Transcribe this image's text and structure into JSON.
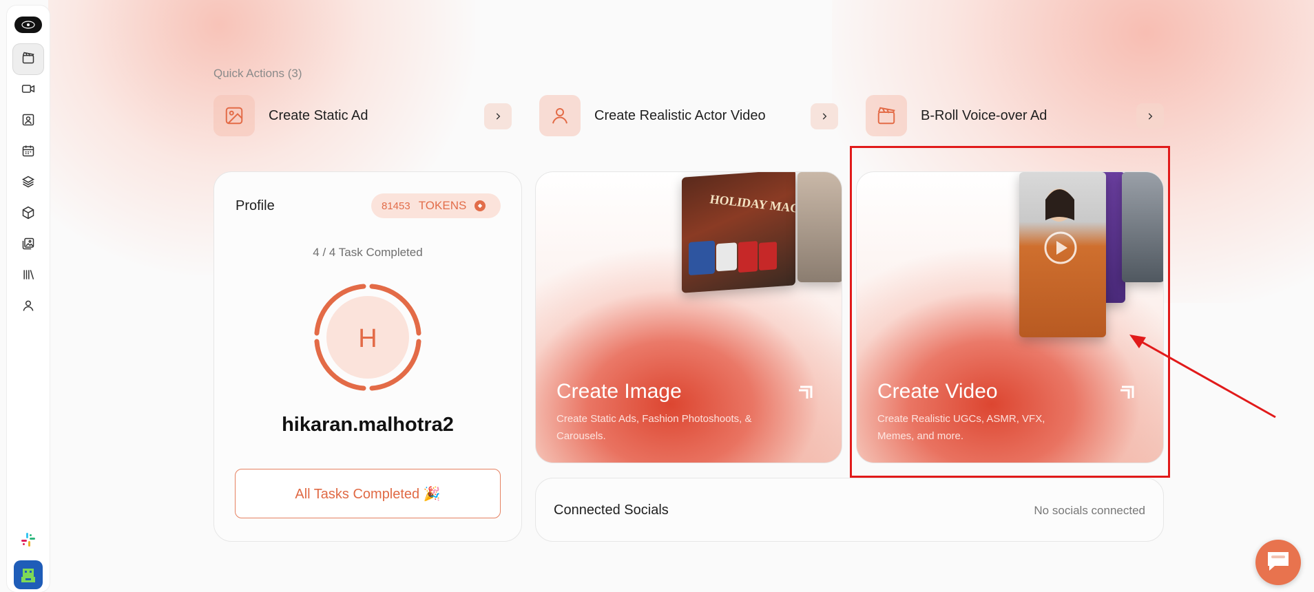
{
  "sidebar": {
    "logo_text": "",
    "items": [
      {
        "name": "clapperboard-icon",
        "active": true
      },
      {
        "name": "video-icon"
      },
      {
        "name": "portrait-icon"
      },
      {
        "name": "calendar-icon"
      },
      {
        "name": "layers-icon"
      },
      {
        "name": "box-icon"
      },
      {
        "name": "gallery-icon"
      },
      {
        "name": "library-icon"
      },
      {
        "name": "user-icon"
      }
    ]
  },
  "quick_actions": {
    "title": "Quick Actions (3)",
    "items": [
      {
        "label": "Create Static Ad",
        "icon": "image-icon"
      },
      {
        "label": "Create Realistic Actor Video",
        "icon": "person-icon"
      },
      {
        "label": "B-Roll Voice-over Ad",
        "icon": "clapperboard-icon"
      }
    ]
  },
  "profile": {
    "title": "Profile",
    "tokens_value": "81453",
    "tokens_label": "TOKENS",
    "task_progress": "4 / 4 Task Completed",
    "avatar_initial": "H",
    "username": "hikaran.malhotra2",
    "tasks_button": "All Tasks Completed 🎉"
  },
  "feature_cards": {
    "image": {
      "title": "Create Image",
      "description": "Create Static Ads, Fashion Photoshoots, & Carousels."
    },
    "video": {
      "title": "Create Video",
      "description": "Create Realistic UGCs, ASMR, VFX, Memes, and more."
    }
  },
  "socials": {
    "title": "Connected Socials",
    "status": "No socials connected"
  },
  "colors": {
    "accent": "#e26d4a",
    "annotation": "#e11a1a"
  }
}
